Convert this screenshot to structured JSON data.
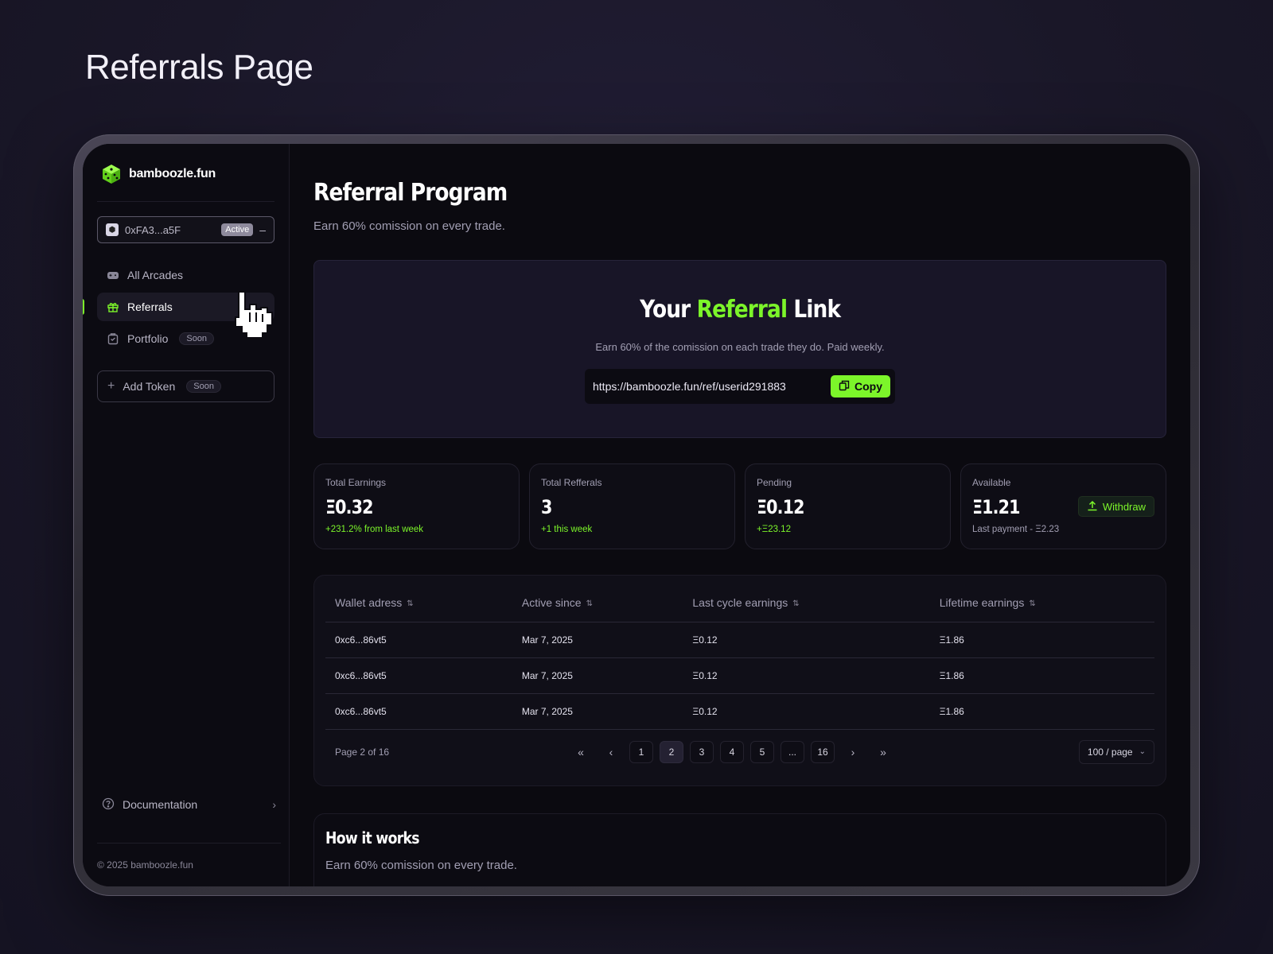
{
  "page_heading": "Referrals Page",
  "brand": {
    "name": "bamboozle.fun"
  },
  "wallet": {
    "address": "0xFA3...a5F",
    "status": "Active",
    "toggle": "–"
  },
  "nav": [
    {
      "label": "All Arcades",
      "icon": "gamepad-icon"
    },
    {
      "label": "Referrals",
      "icon": "gift-icon",
      "active": true
    },
    {
      "label": "Portfolio",
      "icon": "briefcase-icon",
      "badge": "Soon"
    }
  ],
  "add_token": {
    "label": "Add Token",
    "badge": "Soon"
  },
  "documentation": {
    "label": "Documentation"
  },
  "copyright": "© 2025 bamboozle.fun",
  "main": {
    "title": "Referral Program",
    "subtitle": "Earn 60% comission on every trade."
  },
  "referral_card": {
    "title_pre": "Your ",
    "title_accent": "Referral",
    "title_post": " Link",
    "description": "Earn 60% of the comission on each trade they do. Paid weekly.",
    "url": "https://bamboozle.fun/ref/userid291883",
    "copy_label": "Copy"
  },
  "stats": [
    {
      "label": "Total Earnings",
      "value": "Ξ0.32",
      "note": "+231.2% from last week"
    },
    {
      "label": "Total Refferals",
      "value": "3",
      "note": "+1 this week"
    },
    {
      "label": "Pending",
      "value": "Ξ0.12",
      "note": "+Ξ23.12"
    },
    {
      "label": "Available",
      "value": "Ξ1.21",
      "note": "Last payment - Ξ2.23",
      "action": "Withdraw"
    }
  ],
  "table": {
    "columns": [
      "Wallet adress",
      "Active since",
      "Last cycle earnings",
      "Lifetime earnings"
    ],
    "rows": [
      [
        "0xc6...86vt5",
        "Mar 7, 2025",
        "Ξ0.12",
        "Ξ1.86"
      ],
      [
        "0xc6...86vt5",
        "Mar 7, 2025",
        "Ξ0.12",
        "Ξ1.86"
      ],
      [
        "0xc6...86vt5",
        "Mar 7, 2025",
        "Ξ0.12",
        "Ξ1.86"
      ]
    ]
  },
  "pagination": {
    "info": "Page 2 of 16",
    "first": "«",
    "prev": "‹",
    "pages": [
      "1",
      "2",
      "3",
      "4",
      "5",
      "...",
      "16"
    ],
    "current": "2",
    "next": "›",
    "last": "»",
    "per_page": "100 / page"
  },
  "how": {
    "title": "How it works",
    "subtitle": "Earn 60% comission on every trade."
  },
  "colors": {
    "accent": "#7cf52a",
    "background": "#0b0a10",
    "card": "#181527"
  }
}
